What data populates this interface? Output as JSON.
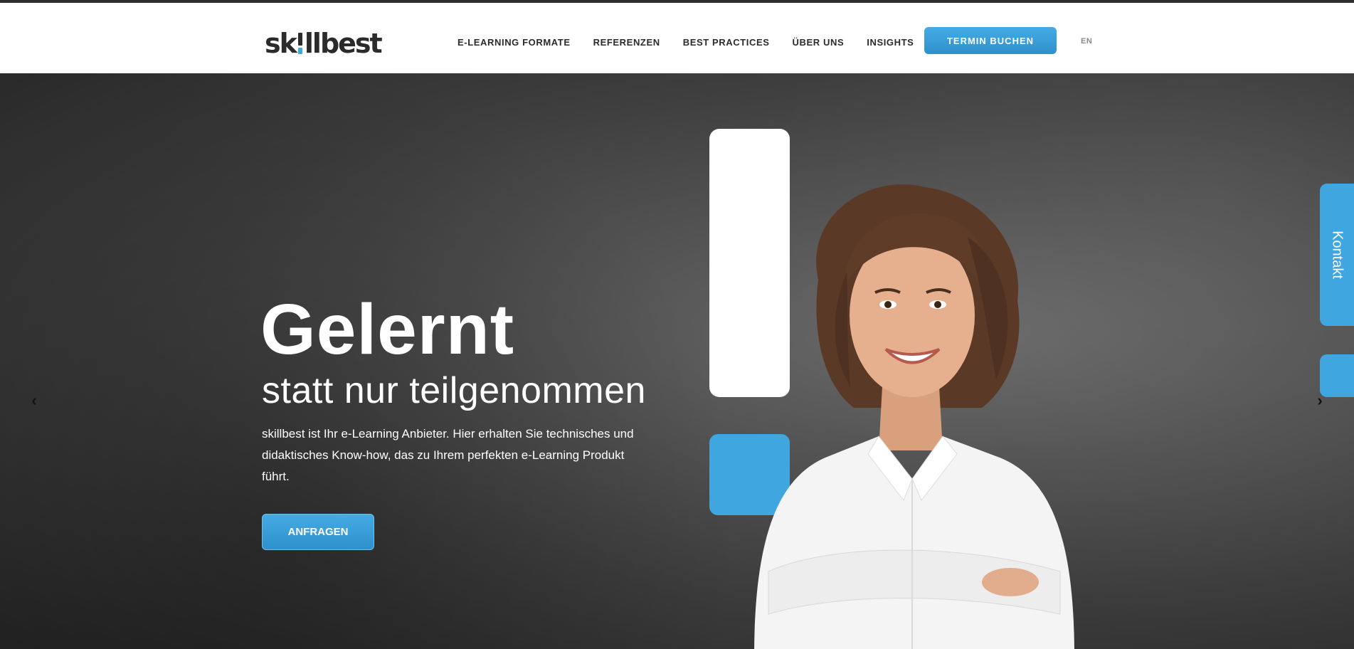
{
  "brand": {
    "logo_text_left": "sk",
    "logo_text_right": "llbest",
    "accent": "#41a9e0",
    "dark": "#2b2b2b"
  },
  "nav": {
    "items": [
      {
        "label": "E-LEARNING FORMATE"
      },
      {
        "label": "REFERENZEN"
      },
      {
        "label": "BEST PRACTICES"
      },
      {
        "label": "ÜBER UNS"
      },
      {
        "label": "INSIGHTS"
      }
    ],
    "cta_label": "TERMIN BUCHEN",
    "language": "EN"
  },
  "hero": {
    "headline": "Gelernt",
    "subline": "statt nur teilgenommen",
    "intro": "skillbest ist Ihr e-Learning Anbieter. Hier erhalten Sie technisches und didaktisches Know-how, das zu Ihrem perfekten e-Learning Produkt führt.",
    "cta_label": "ANFRAGEN",
    "prev_icon": "chevron-left-icon",
    "next_icon": "chevron-right-icon"
  },
  "side": {
    "contact_label": "Kontakt"
  }
}
